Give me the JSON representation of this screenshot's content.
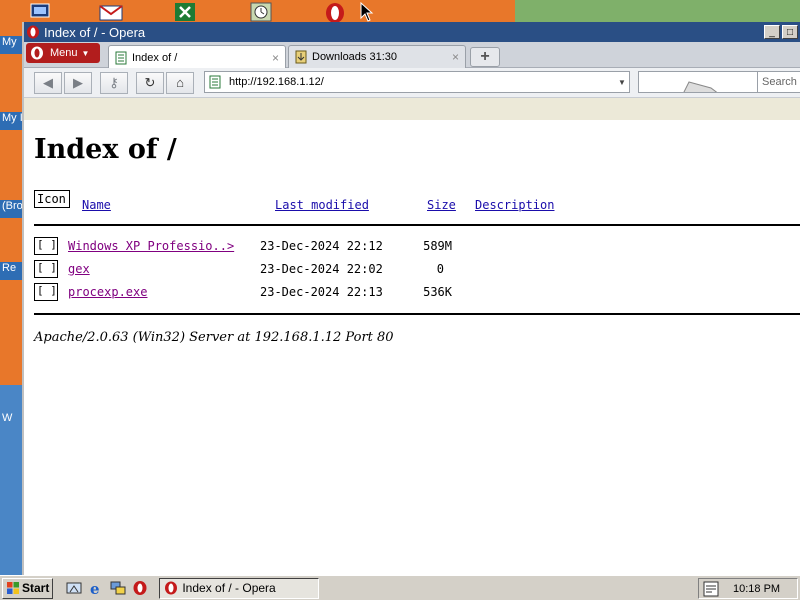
{
  "desktop": {
    "side_labels": [
      "My",
      "My I",
      "(Bro",
      "Re",
      "W"
    ]
  },
  "window": {
    "title": "Index of / - Opera",
    "menu_label": "Menu"
  },
  "tabs": [
    {
      "label": "Index of /",
      "close": "×"
    },
    {
      "label": "Downloads 31:30",
      "close": "×"
    }
  ],
  "toolbar": {
    "url": "http://192.168.1.12/",
    "search_placeholder": "Search"
  },
  "page": {
    "heading": "Index of /",
    "columns": {
      "icon": "Icon",
      "name": "Name",
      "last_modified": "Last modified",
      "size": "Size",
      "description": "Description"
    },
    "rows": [
      {
        "icon": "[ ]",
        "name": "Windows XP Professio..>",
        "modified": "23-Dec-2024 22:12",
        "size": "589M"
      },
      {
        "icon": "[ ]",
        "name": "gex",
        "modified": "23-Dec-2024 22:02",
        "size": "0"
      },
      {
        "icon": "[ ]",
        "name": "procexp.exe",
        "modified": "23-Dec-2024 22:13",
        "size": "536K"
      }
    ],
    "footer": "Apache/2.0.63 (Win32) Server at 192.168.1.12 Port 80"
  },
  "taskbar": {
    "start_label": "Start",
    "task_label": "Index of / - Opera",
    "clock": "10:18 PM"
  },
  "colors": {
    "titlebar": "#2a4f85",
    "opera_red": "#c41a1a",
    "link": "#1a0dab",
    "visited": "#800080"
  }
}
